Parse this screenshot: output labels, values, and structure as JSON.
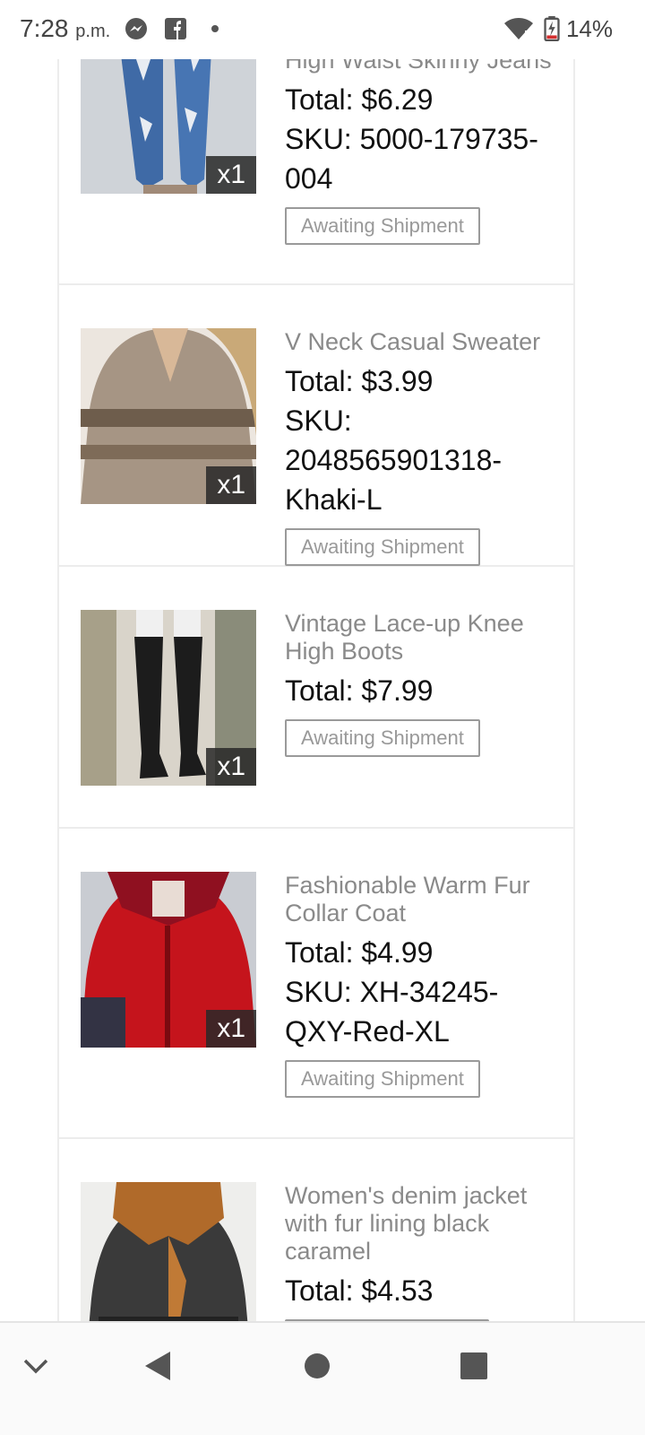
{
  "status": {
    "time": "7:28",
    "ampm": "p.m.",
    "battery": "14%",
    "icons": [
      "messenger-icon",
      "facebook-icon",
      "dot-icon",
      "wifi-icon",
      "battery-icon"
    ]
  },
  "orders": [
    {
      "name": "High Waist Skinny Jeans",
      "total_label": "Total:",
      "total": "$6.29",
      "sku_label": "SKU:",
      "sku_line1": "5000-179735-",
      "sku_line2": "004",
      "qty": "x1",
      "status": "Awaiting Shipment"
    },
    {
      "name": "V Neck Casual Sweater",
      "total_label": "Total:",
      "total": "$3.99",
      "sku_label": "SKU:",
      "sku_line1": "2048565901318-",
      "sku_line2": "Khaki-L",
      "qty": "x1",
      "status": "Awaiting Shipment"
    },
    {
      "name_line1": "Vintage Lace-up Knee",
      "name_line2": "High Boots",
      "total_label": "Total:",
      "total": "$7.99",
      "qty": "x1",
      "status": "Awaiting Shipment"
    },
    {
      "name_line1": "Fashionable Warm Fur",
      "name_line2": "Collar Coat",
      "total_label": "Total:",
      "total": "$4.99",
      "sku_label": "SKU:",
      "sku_line1": "XH-34245-",
      "sku_line2": "QXY-Red-XL",
      "qty": "x1",
      "status": "Awaiting Shipment"
    },
    {
      "name_line1": "Women's denim jacket",
      "name_line2": "with fur lining black",
      "name_line3": "caramel",
      "total_label": "Total:",
      "total": "$4.53"
    }
  ],
  "colors": {
    "accent_text": "#8a8a8a",
    "border": "#ececec",
    "badge_border": "#9a9a9a"
  }
}
